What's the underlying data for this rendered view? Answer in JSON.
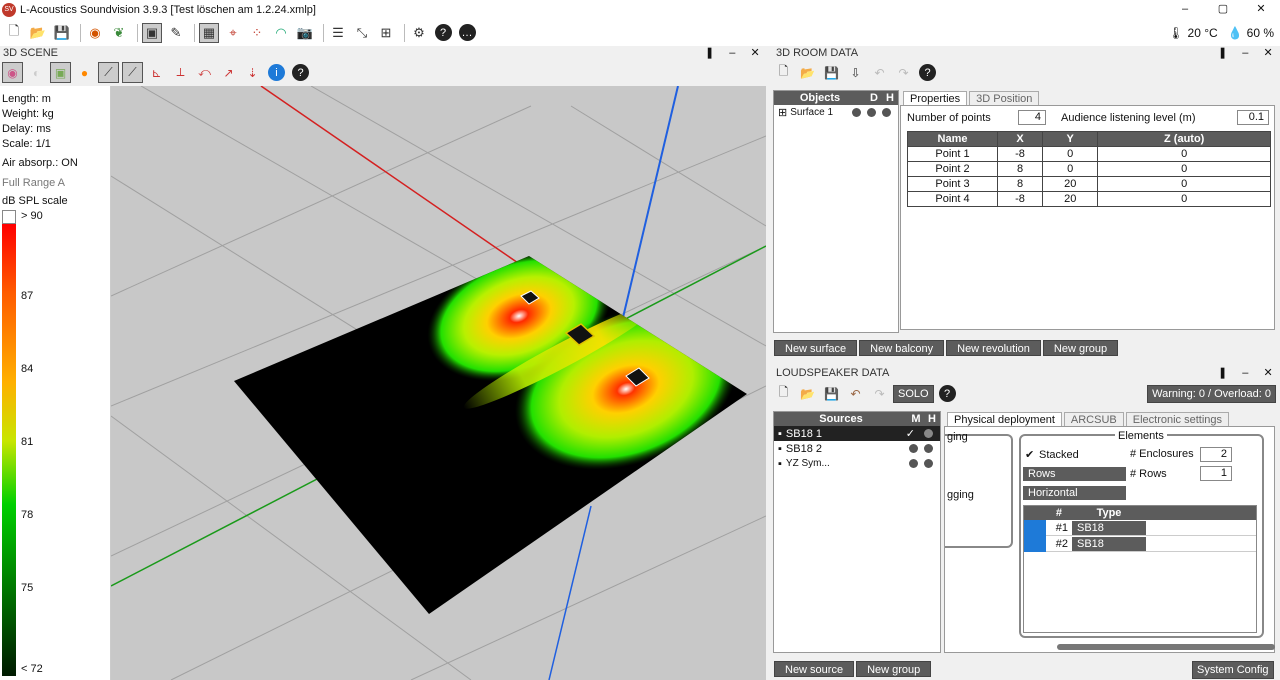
{
  "window": {
    "title": "L-Acoustics Soundvision 3.9.3 [Test löschen am 1.2.24.xmlp]",
    "logo": "SV",
    "minimize": "–",
    "restore": "▢",
    "close": "✕"
  },
  "env": {
    "temperature": "20 °C",
    "humidity": "60 %"
  },
  "scene_panel": {
    "title": "3D SCENE"
  },
  "scene_info": {
    "length": "Length: m",
    "weight": "Weight: kg",
    "delay": "Delay: ms",
    "scale": "Scale: 1/1",
    "air": "Air absorp.: ON",
    "range": "Full Range A",
    "spl": "dB SPL scale"
  },
  "color_scale": {
    "top": "> 90",
    "t87": "87",
    "t84": "84",
    "t81": "81",
    "t78": "78",
    "t75": "75",
    "bottom": "< 72"
  },
  "room_panel": {
    "title": "3D ROOM DATA"
  },
  "objects": {
    "col_objects": "Objects",
    "col_d": "D",
    "col_h": "H",
    "item": "Surface 1"
  },
  "room_tabs": {
    "properties": "Properties",
    "position": "3D Position"
  },
  "surface": {
    "points_label": "Number of points",
    "points_value": "4",
    "audience_label": "Audience listening level (m)",
    "audience_value": "0.1"
  },
  "points_table": {
    "headers": [
      "Name",
      "X",
      "Y",
      "Z (auto)"
    ],
    "rows": [
      [
        "Point 1",
        "-8",
        "0",
        "0"
      ],
      [
        "Point 2",
        "8",
        "0",
        "0"
      ],
      [
        "Point 3",
        "8",
        "20",
        "0"
      ],
      [
        "Point 4",
        "-8",
        "20",
        "0"
      ]
    ]
  },
  "room_buttons": {
    "surface": "New surface",
    "balcony": "New balcony",
    "revolution": "New revolution",
    "group": "New group"
  },
  "ls_panel": {
    "title": "LOUDSPEAKER DATA",
    "solo": "SOLO",
    "warning": "Warning: 0 / Overload: 0"
  },
  "sources": {
    "col_sources": "Sources",
    "col_m": "M",
    "col_h": "H",
    "items": [
      "SB18 1",
      "SB18 2",
      "YZ Sym..."
    ],
    "check": "✓"
  },
  "ls_tabs": {
    "physical": "Physical deployment",
    "arcsub": "ARCSUB",
    "electronic": "Electronic settings"
  },
  "deploy": {
    "partial1": "ging",
    "partial2": "gging",
    "elements_title": "Elements",
    "stacked": "Stacked",
    "enclosures_label": "# Enclosures",
    "enclosures_value": "2",
    "rows_select": "Rows",
    "rows_label": "# Rows",
    "rows_value": "1",
    "orientation": "Horizontal"
  },
  "elements_table": {
    "col_num": "#",
    "col_type": "Type",
    "rows": [
      [
        "#1",
        "SB18"
      ],
      [
        "#2",
        "SB18"
      ]
    ]
  },
  "ls_buttons": {
    "source": "New source",
    "group": "New group",
    "config": "System Config"
  }
}
